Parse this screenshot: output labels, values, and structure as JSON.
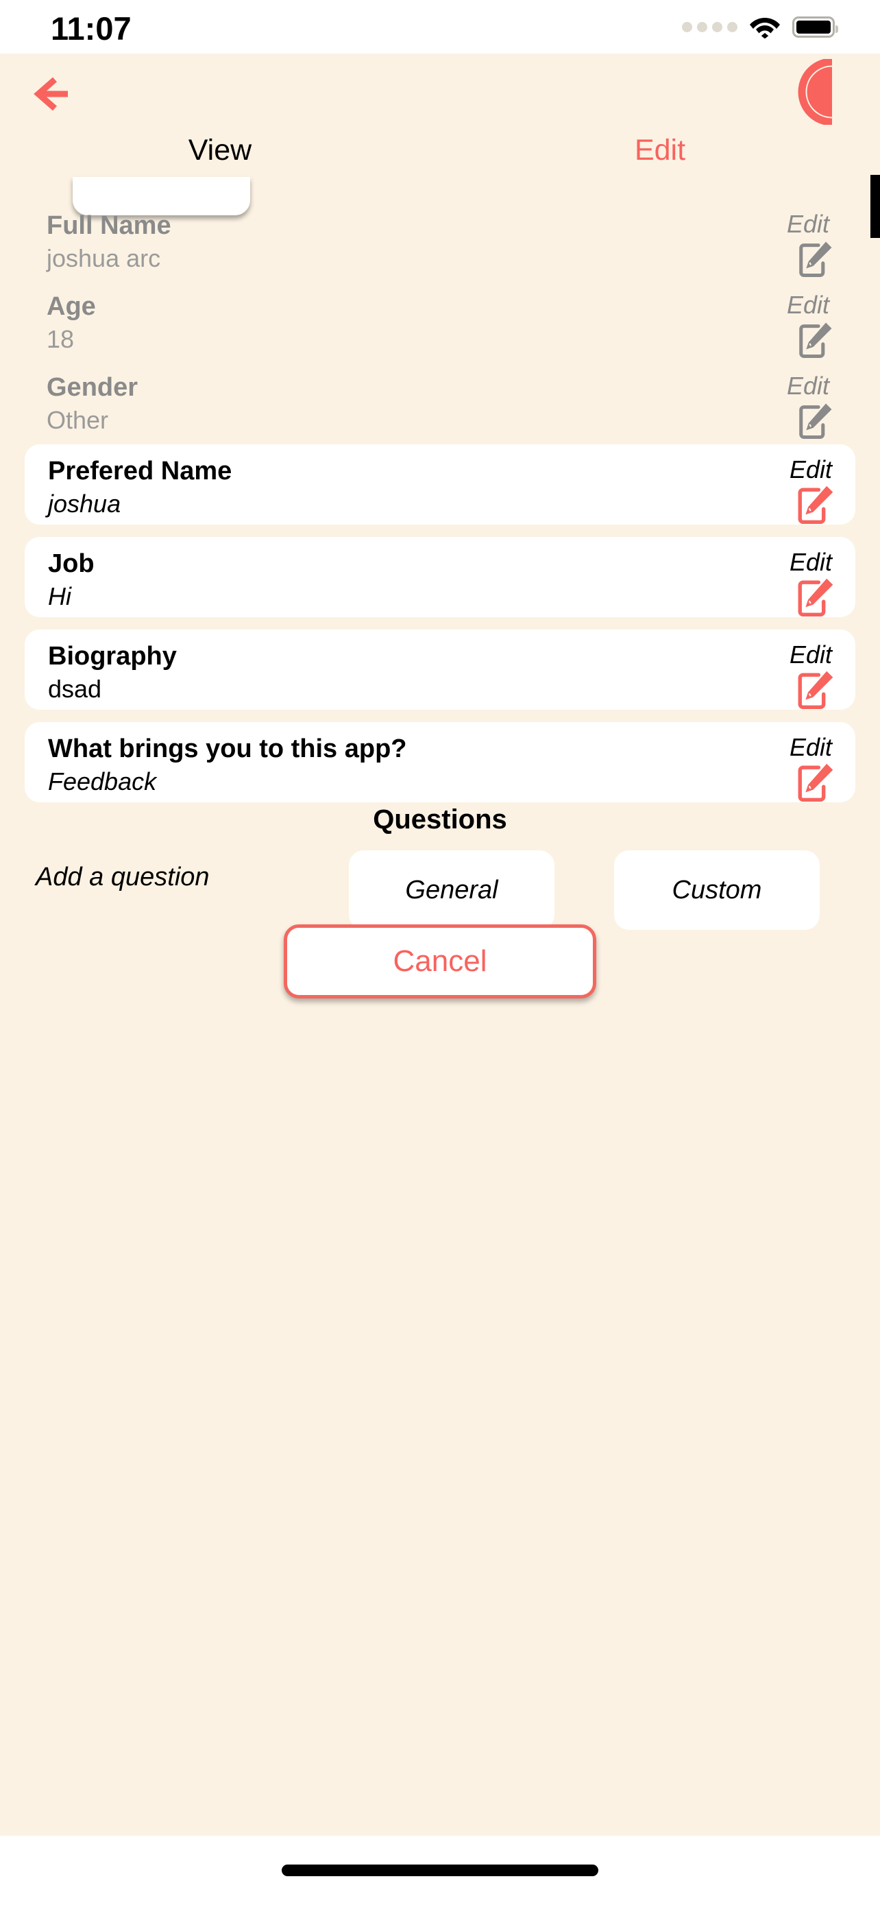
{
  "status_bar": {
    "time": "11:07",
    "cellular_icon": "signal-dots-icon",
    "wifi_icon": "wifi-icon",
    "battery_icon": "battery-full-icon"
  },
  "nav": {
    "back_icon": "back-arrow-icon",
    "logo_icon": "app-logo-icon"
  },
  "tabs": [
    {
      "label": "View",
      "active": true
    },
    {
      "label": "Edit",
      "active": false
    }
  ],
  "plain_fields": [
    {
      "label": "Full Name",
      "value": "joshua arc",
      "edit_label": "Edit",
      "icon": "edit-pencil-icon"
    },
    {
      "label": "Age",
      "value": "18",
      "edit_label": "Edit",
      "icon": "edit-pencil-icon"
    },
    {
      "label": "Gender",
      "value": "Other",
      "edit_label": "Edit",
      "icon": "edit-pencil-icon"
    }
  ],
  "card_fields": [
    {
      "label": "Prefered Name",
      "value": "joshua",
      "edit_label": "Edit",
      "icon": "edit-pencil-icon"
    },
    {
      "label": "Job",
      "value": "Hi",
      "edit_label": "Edit",
      "icon": "edit-pencil-icon"
    },
    {
      "label": "Biography",
      "value": "dsad",
      "edit_label": "Edit",
      "icon": "edit-pencil-icon"
    },
    {
      "label": "What brings you to this app?",
      "value": "Feedback",
      "edit_label": "Edit",
      "icon": "edit-pencil-icon"
    }
  ],
  "questions": {
    "title": "Questions",
    "add_label": "Add a question",
    "general_label": "General",
    "custom_label": "Custom"
  },
  "footer": {
    "cancel_label": "Cancel"
  },
  "colors": {
    "background": "#fbf2e3",
    "accent": "#f8635e",
    "card": "#ffffff",
    "disabled_text": "#8a8a8a"
  }
}
